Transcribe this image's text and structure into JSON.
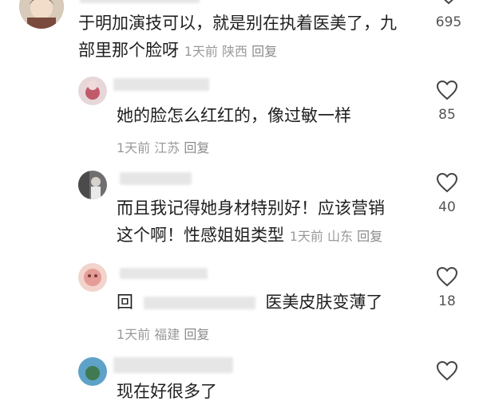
{
  "colors": {
    "text": "#1f1f1f",
    "meta": "#9a9a9a",
    "username": "#b4b4b4",
    "background": "#ffffff"
  },
  "comments": [
    {
      "username": "",
      "text_lines": [
        "于明加演技可以，就是别在执着医美了，九",
        "部里那个脸呀"
      ],
      "time": "1天前",
      "location": "陕西",
      "reply": "回复",
      "likes": "695",
      "icon": "heart-outline-icon"
    },
    {
      "username": "",
      "text_lines": [
        "她的脸怎么红红的，像过敏一样"
      ],
      "time": "1天前",
      "location": "江苏",
      "reply": "回复",
      "likes": "85",
      "icon": "heart-outline-icon"
    },
    {
      "username": "",
      "text_lines": [
        "而且我记得她身材特别好！应该营销",
        "这个啊！性感姐姐类型"
      ],
      "time": "1天前",
      "location": "山东",
      "reply": "回复",
      "likes": "40",
      "icon": "heart-outline-icon"
    },
    {
      "username": "",
      "text_lines": [
        "回",
        "医美皮肤变薄了"
      ],
      "time": "1天前",
      "location": "福建",
      "reply": "回复",
      "likes": "18",
      "icon": "heart-outline-icon"
    },
    {
      "username": "",
      "text_lines": [
        "现在好很多了"
      ],
      "time": "",
      "location": "",
      "reply": "",
      "likes": "",
      "icon": "heart-outline-icon"
    }
  ]
}
